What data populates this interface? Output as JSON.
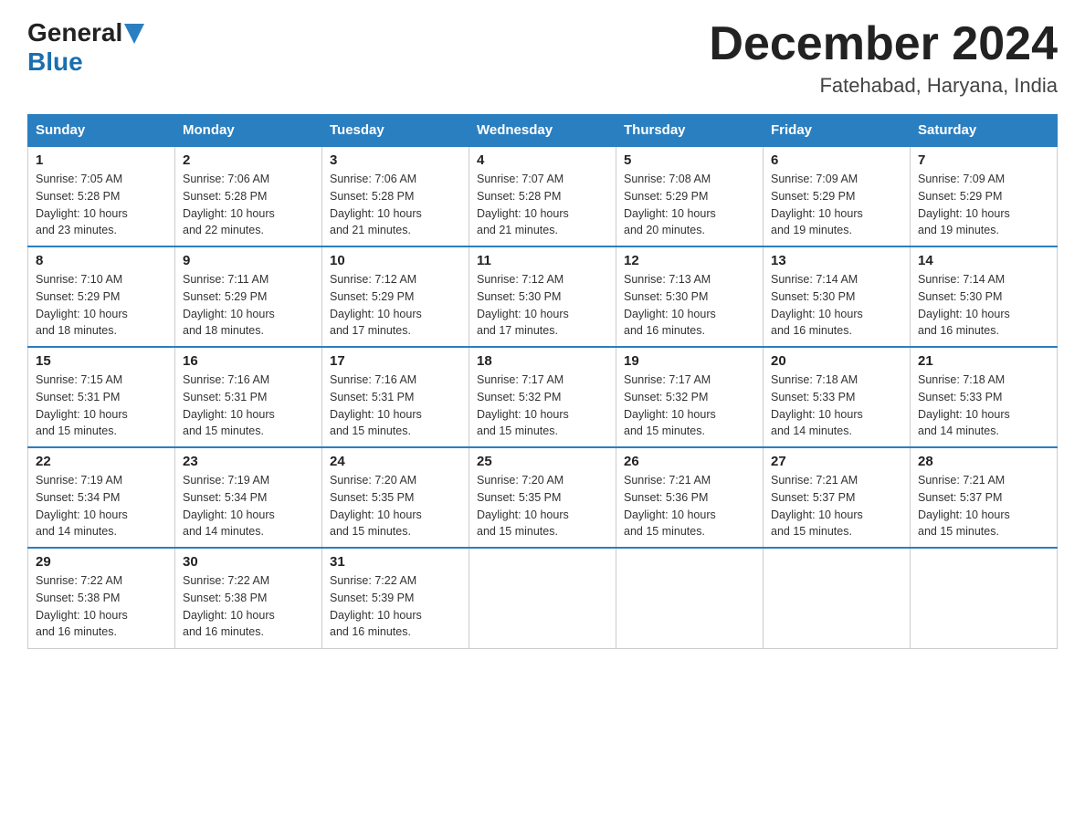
{
  "header": {
    "logo_general": "General",
    "logo_blue": "Blue",
    "title": "December 2024",
    "subtitle": "Fatehabad, Haryana, India"
  },
  "weekdays": [
    "Sunday",
    "Monday",
    "Tuesday",
    "Wednesday",
    "Thursday",
    "Friday",
    "Saturday"
  ],
  "weeks": [
    [
      {
        "day": "1",
        "info": "Sunrise: 7:05 AM\nSunset: 5:28 PM\nDaylight: 10 hours\nand 23 minutes."
      },
      {
        "day": "2",
        "info": "Sunrise: 7:06 AM\nSunset: 5:28 PM\nDaylight: 10 hours\nand 22 minutes."
      },
      {
        "day": "3",
        "info": "Sunrise: 7:06 AM\nSunset: 5:28 PM\nDaylight: 10 hours\nand 21 minutes."
      },
      {
        "day": "4",
        "info": "Sunrise: 7:07 AM\nSunset: 5:28 PM\nDaylight: 10 hours\nand 21 minutes."
      },
      {
        "day": "5",
        "info": "Sunrise: 7:08 AM\nSunset: 5:29 PM\nDaylight: 10 hours\nand 20 minutes."
      },
      {
        "day": "6",
        "info": "Sunrise: 7:09 AM\nSunset: 5:29 PM\nDaylight: 10 hours\nand 19 minutes."
      },
      {
        "day": "7",
        "info": "Sunrise: 7:09 AM\nSunset: 5:29 PM\nDaylight: 10 hours\nand 19 minutes."
      }
    ],
    [
      {
        "day": "8",
        "info": "Sunrise: 7:10 AM\nSunset: 5:29 PM\nDaylight: 10 hours\nand 18 minutes."
      },
      {
        "day": "9",
        "info": "Sunrise: 7:11 AM\nSunset: 5:29 PM\nDaylight: 10 hours\nand 18 minutes."
      },
      {
        "day": "10",
        "info": "Sunrise: 7:12 AM\nSunset: 5:29 PM\nDaylight: 10 hours\nand 17 minutes."
      },
      {
        "day": "11",
        "info": "Sunrise: 7:12 AM\nSunset: 5:30 PM\nDaylight: 10 hours\nand 17 minutes."
      },
      {
        "day": "12",
        "info": "Sunrise: 7:13 AM\nSunset: 5:30 PM\nDaylight: 10 hours\nand 16 minutes."
      },
      {
        "day": "13",
        "info": "Sunrise: 7:14 AM\nSunset: 5:30 PM\nDaylight: 10 hours\nand 16 minutes."
      },
      {
        "day": "14",
        "info": "Sunrise: 7:14 AM\nSunset: 5:30 PM\nDaylight: 10 hours\nand 16 minutes."
      }
    ],
    [
      {
        "day": "15",
        "info": "Sunrise: 7:15 AM\nSunset: 5:31 PM\nDaylight: 10 hours\nand 15 minutes."
      },
      {
        "day": "16",
        "info": "Sunrise: 7:16 AM\nSunset: 5:31 PM\nDaylight: 10 hours\nand 15 minutes."
      },
      {
        "day": "17",
        "info": "Sunrise: 7:16 AM\nSunset: 5:31 PM\nDaylight: 10 hours\nand 15 minutes."
      },
      {
        "day": "18",
        "info": "Sunrise: 7:17 AM\nSunset: 5:32 PM\nDaylight: 10 hours\nand 15 minutes."
      },
      {
        "day": "19",
        "info": "Sunrise: 7:17 AM\nSunset: 5:32 PM\nDaylight: 10 hours\nand 15 minutes."
      },
      {
        "day": "20",
        "info": "Sunrise: 7:18 AM\nSunset: 5:33 PM\nDaylight: 10 hours\nand 14 minutes."
      },
      {
        "day": "21",
        "info": "Sunrise: 7:18 AM\nSunset: 5:33 PM\nDaylight: 10 hours\nand 14 minutes."
      }
    ],
    [
      {
        "day": "22",
        "info": "Sunrise: 7:19 AM\nSunset: 5:34 PM\nDaylight: 10 hours\nand 14 minutes."
      },
      {
        "day": "23",
        "info": "Sunrise: 7:19 AM\nSunset: 5:34 PM\nDaylight: 10 hours\nand 14 minutes."
      },
      {
        "day": "24",
        "info": "Sunrise: 7:20 AM\nSunset: 5:35 PM\nDaylight: 10 hours\nand 15 minutes."
      },
      {
        "day": "25",
        "info": "Sunrise: 7:20 AM\nSunset: 5:35 PM\nDaylight: 10 hours\nand 15 minutes."
      },
      {
        "day": "26",
        "info": "Sunrise: 7:21 AM\nSunset: 5:36 PM\nDaylight: 10 hours\nand 15 minutes."
      },
      {
        "day": "27",
        "info": "Sunrise: 7:21 AM\nSunset: 5:37 PM\nDaylight: 10 hours\nand 15 minutes."
      },
      {
        "day": "28",
        "info": "Sunrise: 7:21 AM\nSunset: 5:37 PM\nDaylight: 10 hours\nand 15 minutes."
      }
    ],
    [
      {
        "day": "29",
        "info": "Sunrise: 7:22 AM\nSunset: 5:38 PM\nDaylight: 10 hours\nand 16 minutes."
      },
      {
        "day": "30",
        "info": "Sunrise: 7:22 AM\nSunset: 5:38 PM\nDaylight: 10 hours\nand 16 minutes."
      },
      {
        "day": "31",
        "info": "Sunrise: 7:22 AM\nSunset: 5:39 PM\nDaylight: 10 hours\nand 16 minutes."
      },
      {
        "day": "",
        "info": ""
      },
      {
        "day": "",
        "info": ""
      },
      {
        "day": "",
        "info": ""
      },
      {
        "day": "",
        "info": ""
      }
    ]
  ]
}
